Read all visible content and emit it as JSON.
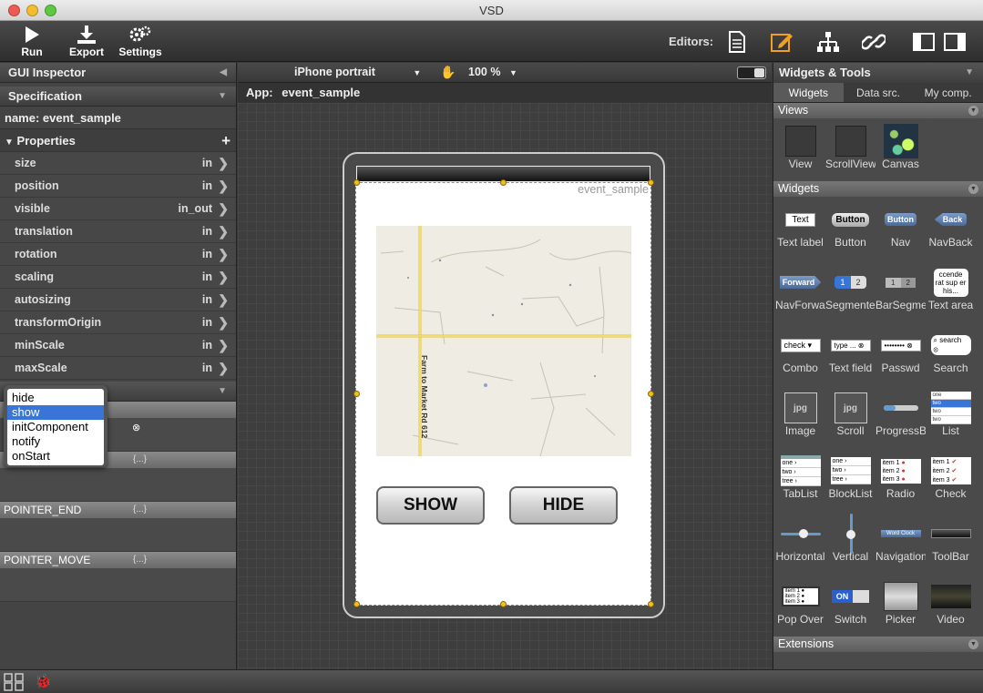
{
  "window": {
    "title": "VSD"
  },
  "toolbar": {
    "run": "Run",
    "export": "Export",
    "settings": "Settings",
    "editors_label": "Editors:"
  },
  "left_panel": {
    "title": "GUI Inspector",
    "spec_title": "Specification",
    "name_label": "name:",
    "name_value": "event_sample",
    "props_title": "Properties",
    "properties": [
      {
        "name": "size",
        "value": "in"
      },
      {
        "name": "position",
        "value": "in"
      },
      {
        "name": "visible",
        "value": "in_out"
      },
      {
        "name": "translation",
        "value": "in"
      },
      {
        "name": "rotation",
        "value": "in"
      },
      {
        "name": "scaling",
        "value": "in"
      },
      {
        "name": "autosizing",
        "value": "in"
      },
      {
        "name": "transformOrigin",
        "value": "in"
      },
      {
        "name": "minScale",
        "value": "in"
      },
      {
        "name": "maxScale",
        "value": "in"
      }
    ],
    "events": [
      "POINTER_START",
      "POINTER_END",
      "POINTER_MOVE"
    ],
    "popup_options": [
      "hide",
      "show",
      "initComponent",
      "notify",
      "onStart"
    ],
    "popup_selected": "show"
  },
  "canvas": {
    "device": "iPhone portrait",
    "zoom": "100 %",
    "app_label": "App:",
    "app_name": "event_sample",
    "screen_label": "event_sample",
    "map_road": "Farm to Market Rd 612",
    "show_button": "SHOW",
    "hide_button": "HIDE"
  },
  "right_panel": {
    "title": "Widgets & Tools",
    "tabs": [
      "Widgets",
      "Data src.",
      "My comp."
    ],
    "sections": {
      "views": "Views",
      "widgets": "Widgets",
      "extensions": "Extensions"
    },
    "views": [
      "View",
      "ScrollView",
      "Canvas"
    ],
    "widgets": [
      "Text label",
      "Button",
      "Nav",
      "NavBack",
      "NavForwar",
      "Segmentec",
      "BarSegmer",
      "Text area",
      "Combo",
      "Text field",
      "Passwd",
      "Search",
      "Image",
      "Scroll",
      "ProgressB:",
      "List",
      "TabList",
      "BlockList",
      "Radio",
      "Check",
      "Horizontal",
      "Vertical",
      "Navigation",
      "ToolBar",
      "Pop Over",
      "Switch",
      "Picker",
      "Video"
    ],
    "thumb_text": {
      "text": "Text",
      "button": "Button",
      "nav": "Button",
      "navback": "Back",
      "navforward": "Forward",
      "seg1": "1",
      "seg2": "2",
      "textarea": "ccende rat sup er his...",
      "combo": "check",
      "textfield": "type ...",
      "passwd": "••••••••",
      "search": "search",
      "switch_on": "ON",
      "image": "jpg",
      "list_items": [
        "one",
        "two",
        "two",
        "two"
      ],
      "tab_items": [
        "one",
        "two",
        "tree"
      ],
      "check_items": [
        "item 1",
        "item 2",
        "item 3"
      ],
      "navigation": "Word Clock"
    }
  },
  "colors": {
    "accent": "#3875d7",
    "handle": "#f0c020",
    "selected_tab_icon": "#f0a020"
  }
}
